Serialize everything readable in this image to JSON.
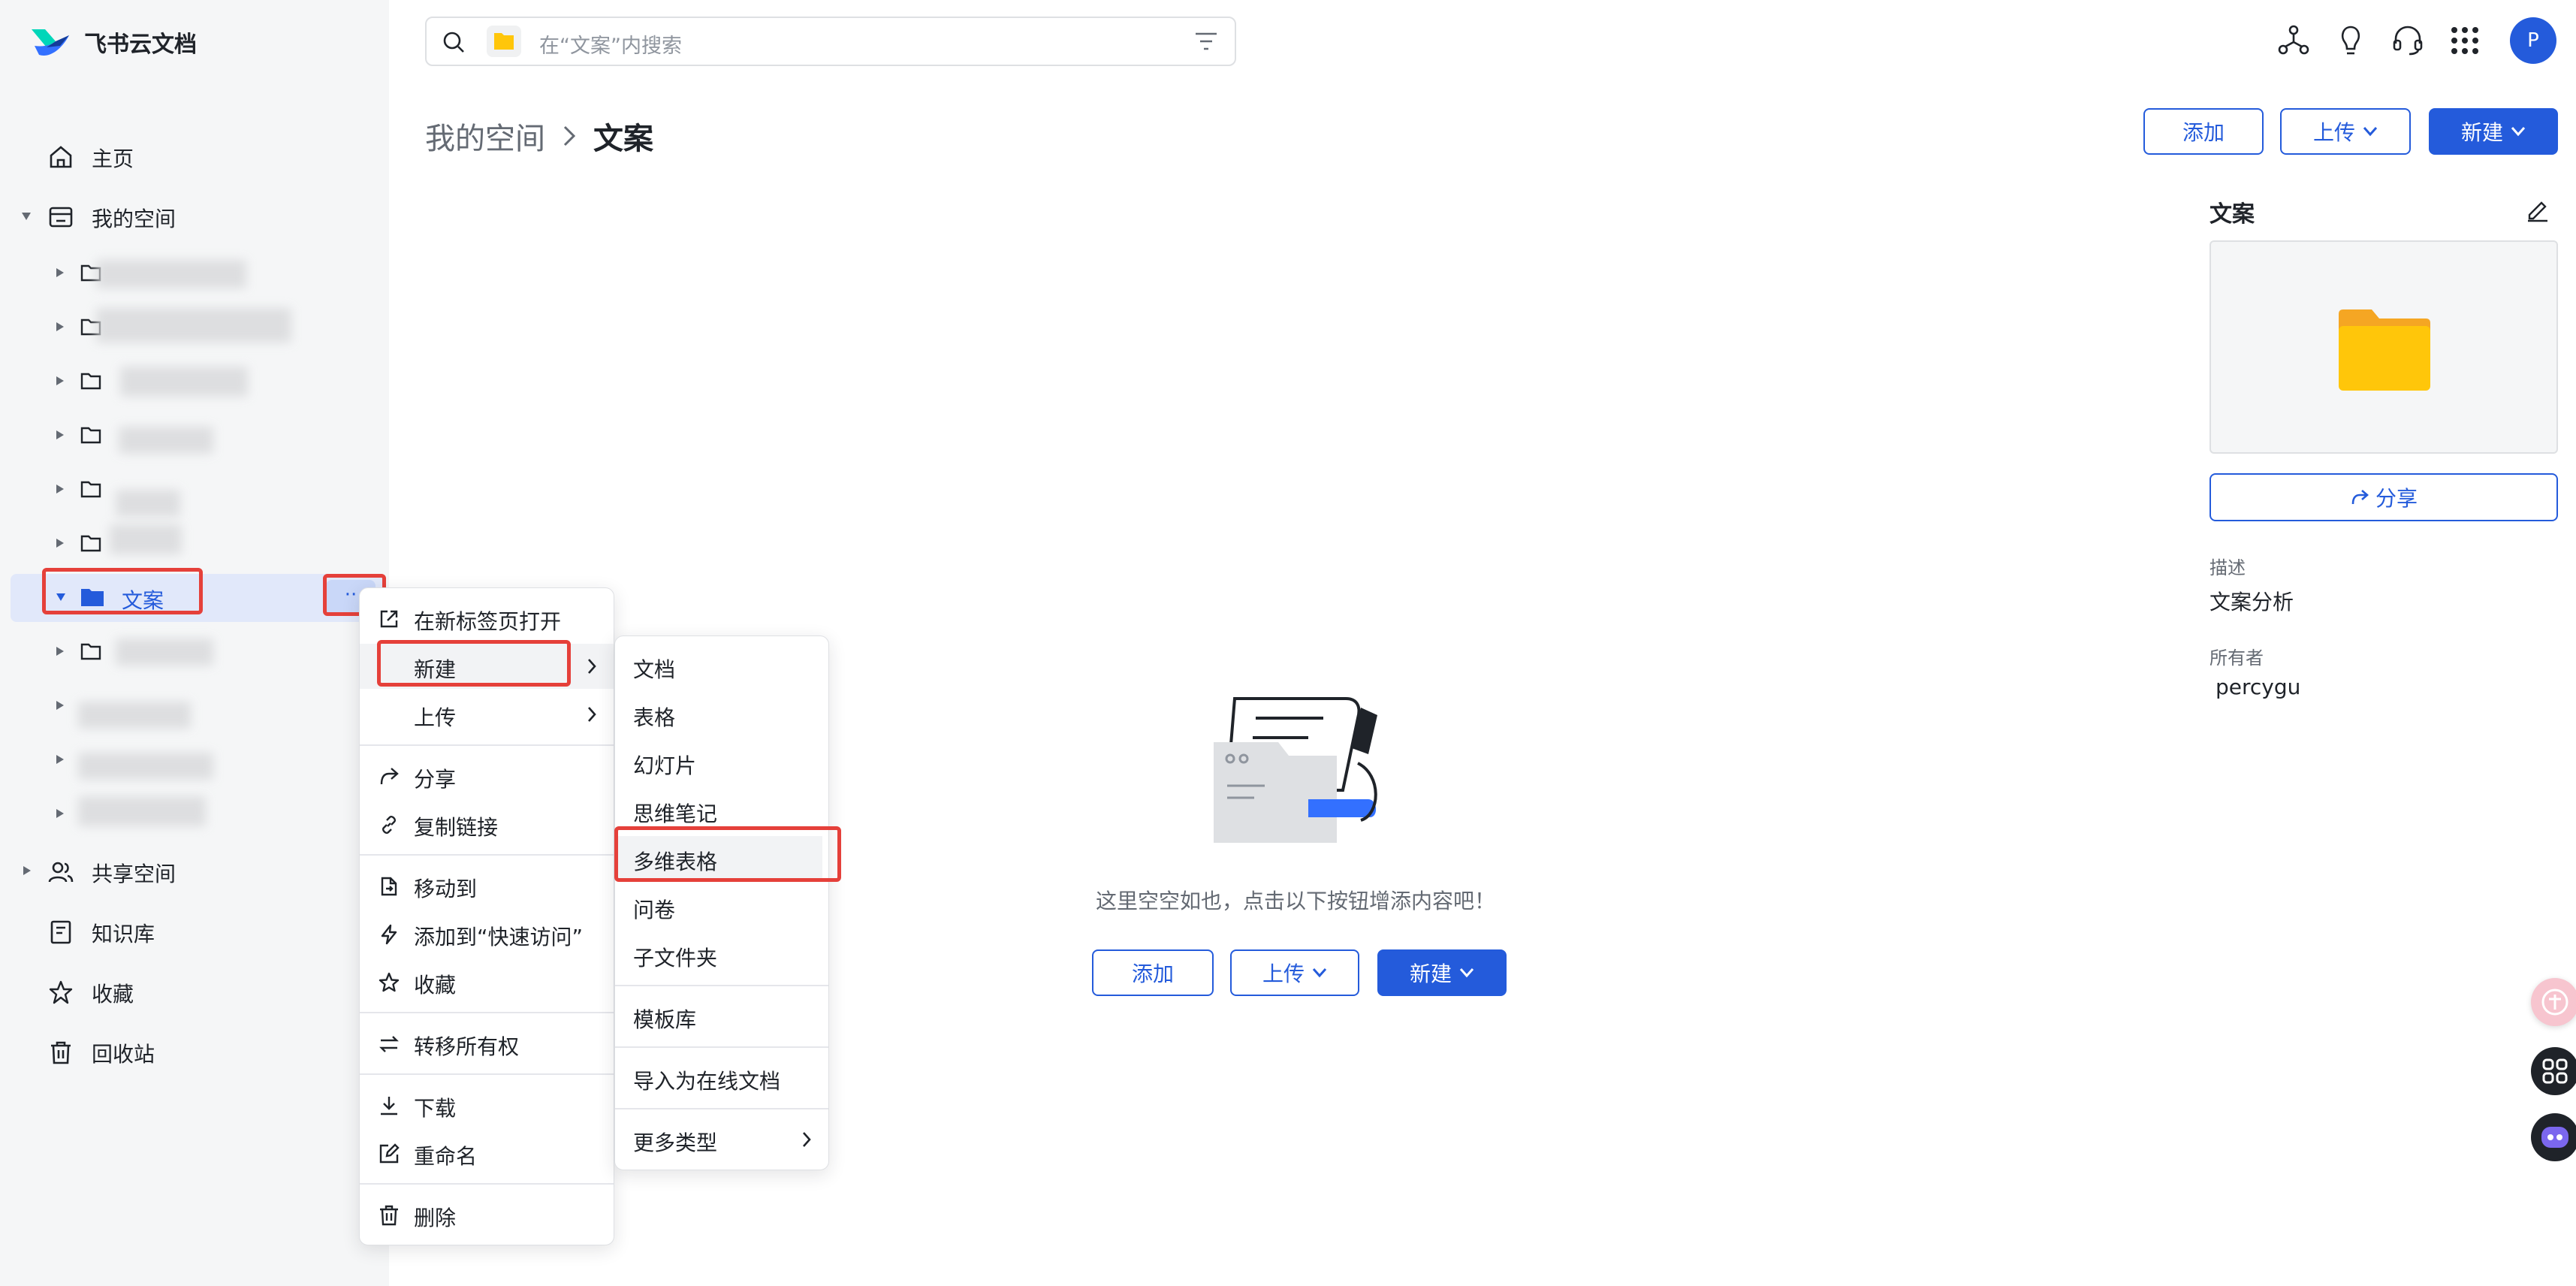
{
  "app": {
    "name": "飞书云文档"
  },
  "sidebar": {
    "home": "主页",
    "my_space": "我的空间",
    "selected_folder": "文案",
    "shared_space": "共享空间",
    "wiki": "知识库",
    "favorites": "收藏",
    "trash": "回收站",
    "more_button": "··"
  },
  "search": {
    "placeholder": "在“文案”内搜索"
  },
  "user": {
    "avatar_initial": "P"
  },
  "breadcrumb": {
    "root": "我的空间",
    "current": "文案"
  },
  "header_actions": {
    "add": "添加",
    "upload": "上传",
    "new": "新建"
  },
  "empty_state": {
    "message": "这里空空如也，点击以下按钮增添内容吧！",
    "add": "添加",
    "upload": "上传",
    "new": "新建"
  },
  "details_panel": {
    "title": "文案",
    "share": "分享",
    "description_label": "描述",
    "description": "文案分析",
    "owner_label": "所有者",
    "owner": "percygu"
  },
  "context_menu": {
    "open_new_tab": "在新标签页打开",
    "new": "新建",
    "upload": "上传",
    "share": "分享",
    "copy_link": "复制链接",
    "move_to": "移动到",
    "add_quick_access": "添加到“快速访问”",
    "favorite": "收藏",
    "transfer_ownership": "转移所有权",
    "download": "下载",
    "rename": "重命名",
    "delete": "删除"
  },
  "new_submenu": {
    "doc": "文档",
    "sheet": "表格",
    "slides": "幻灯片",
    "mindnote": "思维笔记",
    "bitable": "多维表格",
    "survey": "问卷",
    "subfolder": "子文件夹",
    "templates": "模板库",
    "import": "导入为在线文档",
    "more_types": "更多类型"
  },
  "colors": {
    "accent": "#245bdb",
    "highlight_box": "#e5403a",
    "folder_yellow": "#ffc60a"
  }
}
